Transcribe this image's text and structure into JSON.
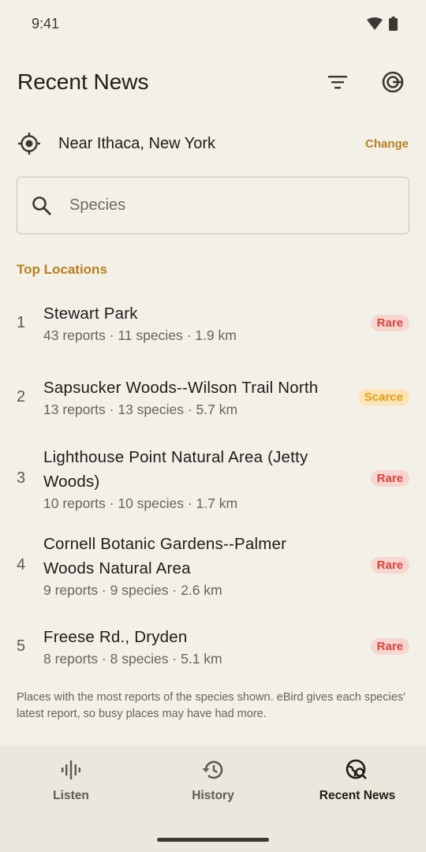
{
  "status": {
    "time": "9:41"
  },
  "header": {
    "title": "Recent News",
    "filter_icon": "filter-icon",
    "target_icon": "target-icon"
  },
  "location": {
    "text": "Near Ithaca, New York",
    "change_label": "Change",
    "icon": "location-crosshair-icon"
  },
  "search": {
    "placeholder": "Species",
    "value": ""
  },
  "top_locations": {
    "title": "Top Locations",
    "items": [
      {
        "rank": "1",
        "name": "Stewart Park",
        "meta": "43 reports · 11 species · 1.9 km",
        "badge": "Rare",
        "badge_type": "rare"
      },
      {
        "rank": "2",
        "name": "Sapsucker Woods--Wilson Trail North",
        "meta": "13 reports · 13 species · 5.7 km",
        "badge": "Scarce",
        "badge_type": "scarce"
      },
      {
        "rank": "3",
        "name": "Lighthouse Point Natural Area (Jetty Woods)",
        "meta": "10 reports · 10 species · 1.7 km",
        "badge": "Rare",
        "badge_type": "rare"
      },
      {
        "rank": "4",
        "name": "Cornell Botanic Gardens--Palmer Woods Natural Area",
        "meta": "9 reports · 9 species · 2.6 km",
        "badge": "Rare",
        "badge_type": "rare"
      },
      {
        "rank": "5",
        "name": "Freese Rd., Dryden",
        "meta": "8 reports · 8 species · 5.1 km",
        "badge": "Rare",
        "badge_type": "rare"
      }
    ]
  },
  "footnote": "Places with the most reports of the species shown. eBird gives each species' latest report, so busy places may have had more.",
  "nav": {
    "items": [
      {
        "label": "Listen",
        "icon": "waveform-icon",
        "active": false
      },
      {
        "label": "History",
        "icon": "history-icon",
        "active": false
      },
      {
        "label": "Recent News",
        "icon": "globe-search-icon",
        "active": true
      }
    ]
  },
  "colors": {
    "accent": "#b8801e",
    "rare_bg": "#f7d6d0",
    "rare_fg": "#d9433a",
    "scarce_bg": "#fbe5b4",
    "scarce_fg": "#e49a14",
    "background": "#f3f0e8"
  }
}
